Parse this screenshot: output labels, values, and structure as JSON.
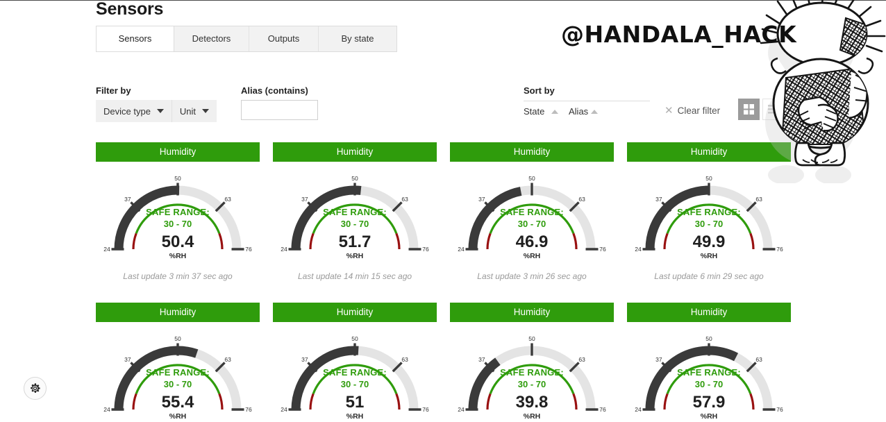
{
  "page": {
    "title": "Sensors"
  },
  "tabs": [
    {
      "label": "Sensors",
      "active": true
    },
    {
      "label": "Detectors",
      "active": false
    },
    {
      "label": "Outputs",
      "active": false
    },
    {
      "label": "By state",
      "active": false
    }
  ],
  "filters": {
    "filter_by_label": "Filter by",
    "device_type_label": "Device type",
    "unit_label": "Unit",
    "alias_label": "Alias (contains)",
    "alias_value": "",
    "alias_placeholder": ""
  },
  "sort": {
    "sort_by_label": "Sort by",
    "state_label": "State",
    "alias_label": "Alias",
    "clear_filter_label": "Clear filter"
  },
  "view": {
    "grid_label": "grid-view",
    "list_label": "list-view",
    "active": "grid"
  },
  "gauge_common": {
    "unit": "%RH",
    "safe_range_title": "SAFE RANGE:",
    "safe_range_value": "30 - 70",
    "ticks": [
      "24",
      "37",
      "50",
      "63",
      "76"
    ],
    "scale_min": 24,
    "scale_max": 76,
    "safe_min": 30,
    "safe_max": 70,
    "fill_color": "#3a3a3a",
    "track_color": "#e4e4e4",
    "safe_color": "#2f9c0c",
    "danger_color": "#991111",
    "header_color": "#2f9c0c"
  },
  "cards": [
    {
      "title": "Humidity",
      "value": "50.4",
      "numeric": 50.4,
      "updated": "Last update 3 min 37 sec ago"
    },
    {
      "title": "Humidity",
      "value": "51.7",
      "numeric": 51.7,
      "updated": "Last update 14 min 15 sec ago"
    },
    {
      "title": "Humidity",
      "value": "46.9",
      "numeric": 46.9,
      "updated": "Last update 3 min 26 sec ago"
    },
    {
      "title": "Humidity",
      "value": "49.9",
      "numeric": 49.9,
      "updated": "Last update 6 min 29 sec ago"
    },
    {
      "title": "Humidity",
      "value": "55.4",
      "numeric": 55.4,
      "updated": ""
    },
    {
      "title": "Humidity",
      "value": "51",
      "numeric": 51.0,
      "updated": ""
    },
    {
      "title": "Humidity",
      "value": "39.8",
      "numeric": 39.8,
      "updated": ""
    },
    {
      "title": "Humidity",
      "value": "57.9",
      "numeric": 57.9,
      "updated": ""
    }
  ],
  "watermark": {
    "text": "@HANDALA_HACK",
    "figure": "handala-cartoon"
  },
  "settings": {
    "gear_label": "settings"
  }
}
